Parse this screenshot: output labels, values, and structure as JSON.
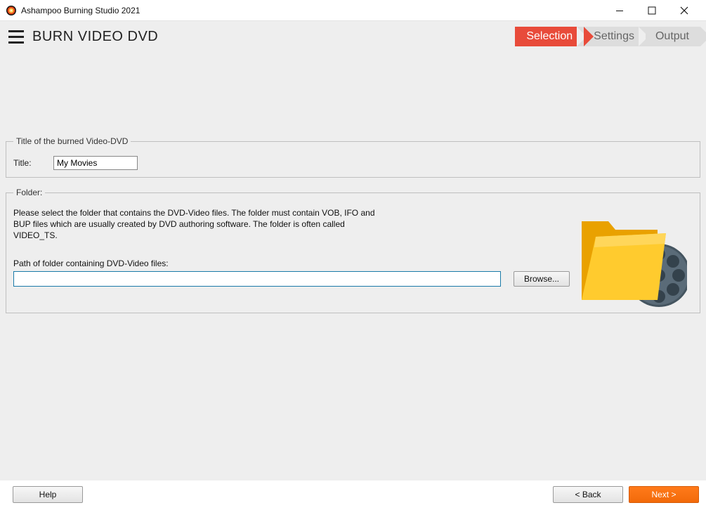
{
  "window": {
    "title": "Ashampoo Burning Studio 2021"
  },
  "header": {
    "page_title": "BURN VIDEO DVD",
    "steps": [
      "Selection",
      "Settings",
      "Output"
    ],
    "active_step_index": 0
  },
  "title_group": {
    "legend": "Title of the burned Video-DVD",
    "title_label": "Title:",
    "title_value": "My Movies"
  },
  "folder_group": {
    "legend": "Folder:",
    "description": "Please select the folder that contains the DVD-Video files. The folder must contain VOB, IFO and BUP files which are usually created by DVD authoring software. The folder is often called VIDEO_TS.",
    "path_label": "Path of folder containing DVD-Video files:",
    "path_value": "",
    "browse_label": "Browse..."
  },
  "footer": {
    "help_label": "Help",
    "back_label": "< Back",
    "next_label": "Next >"
  }
}
